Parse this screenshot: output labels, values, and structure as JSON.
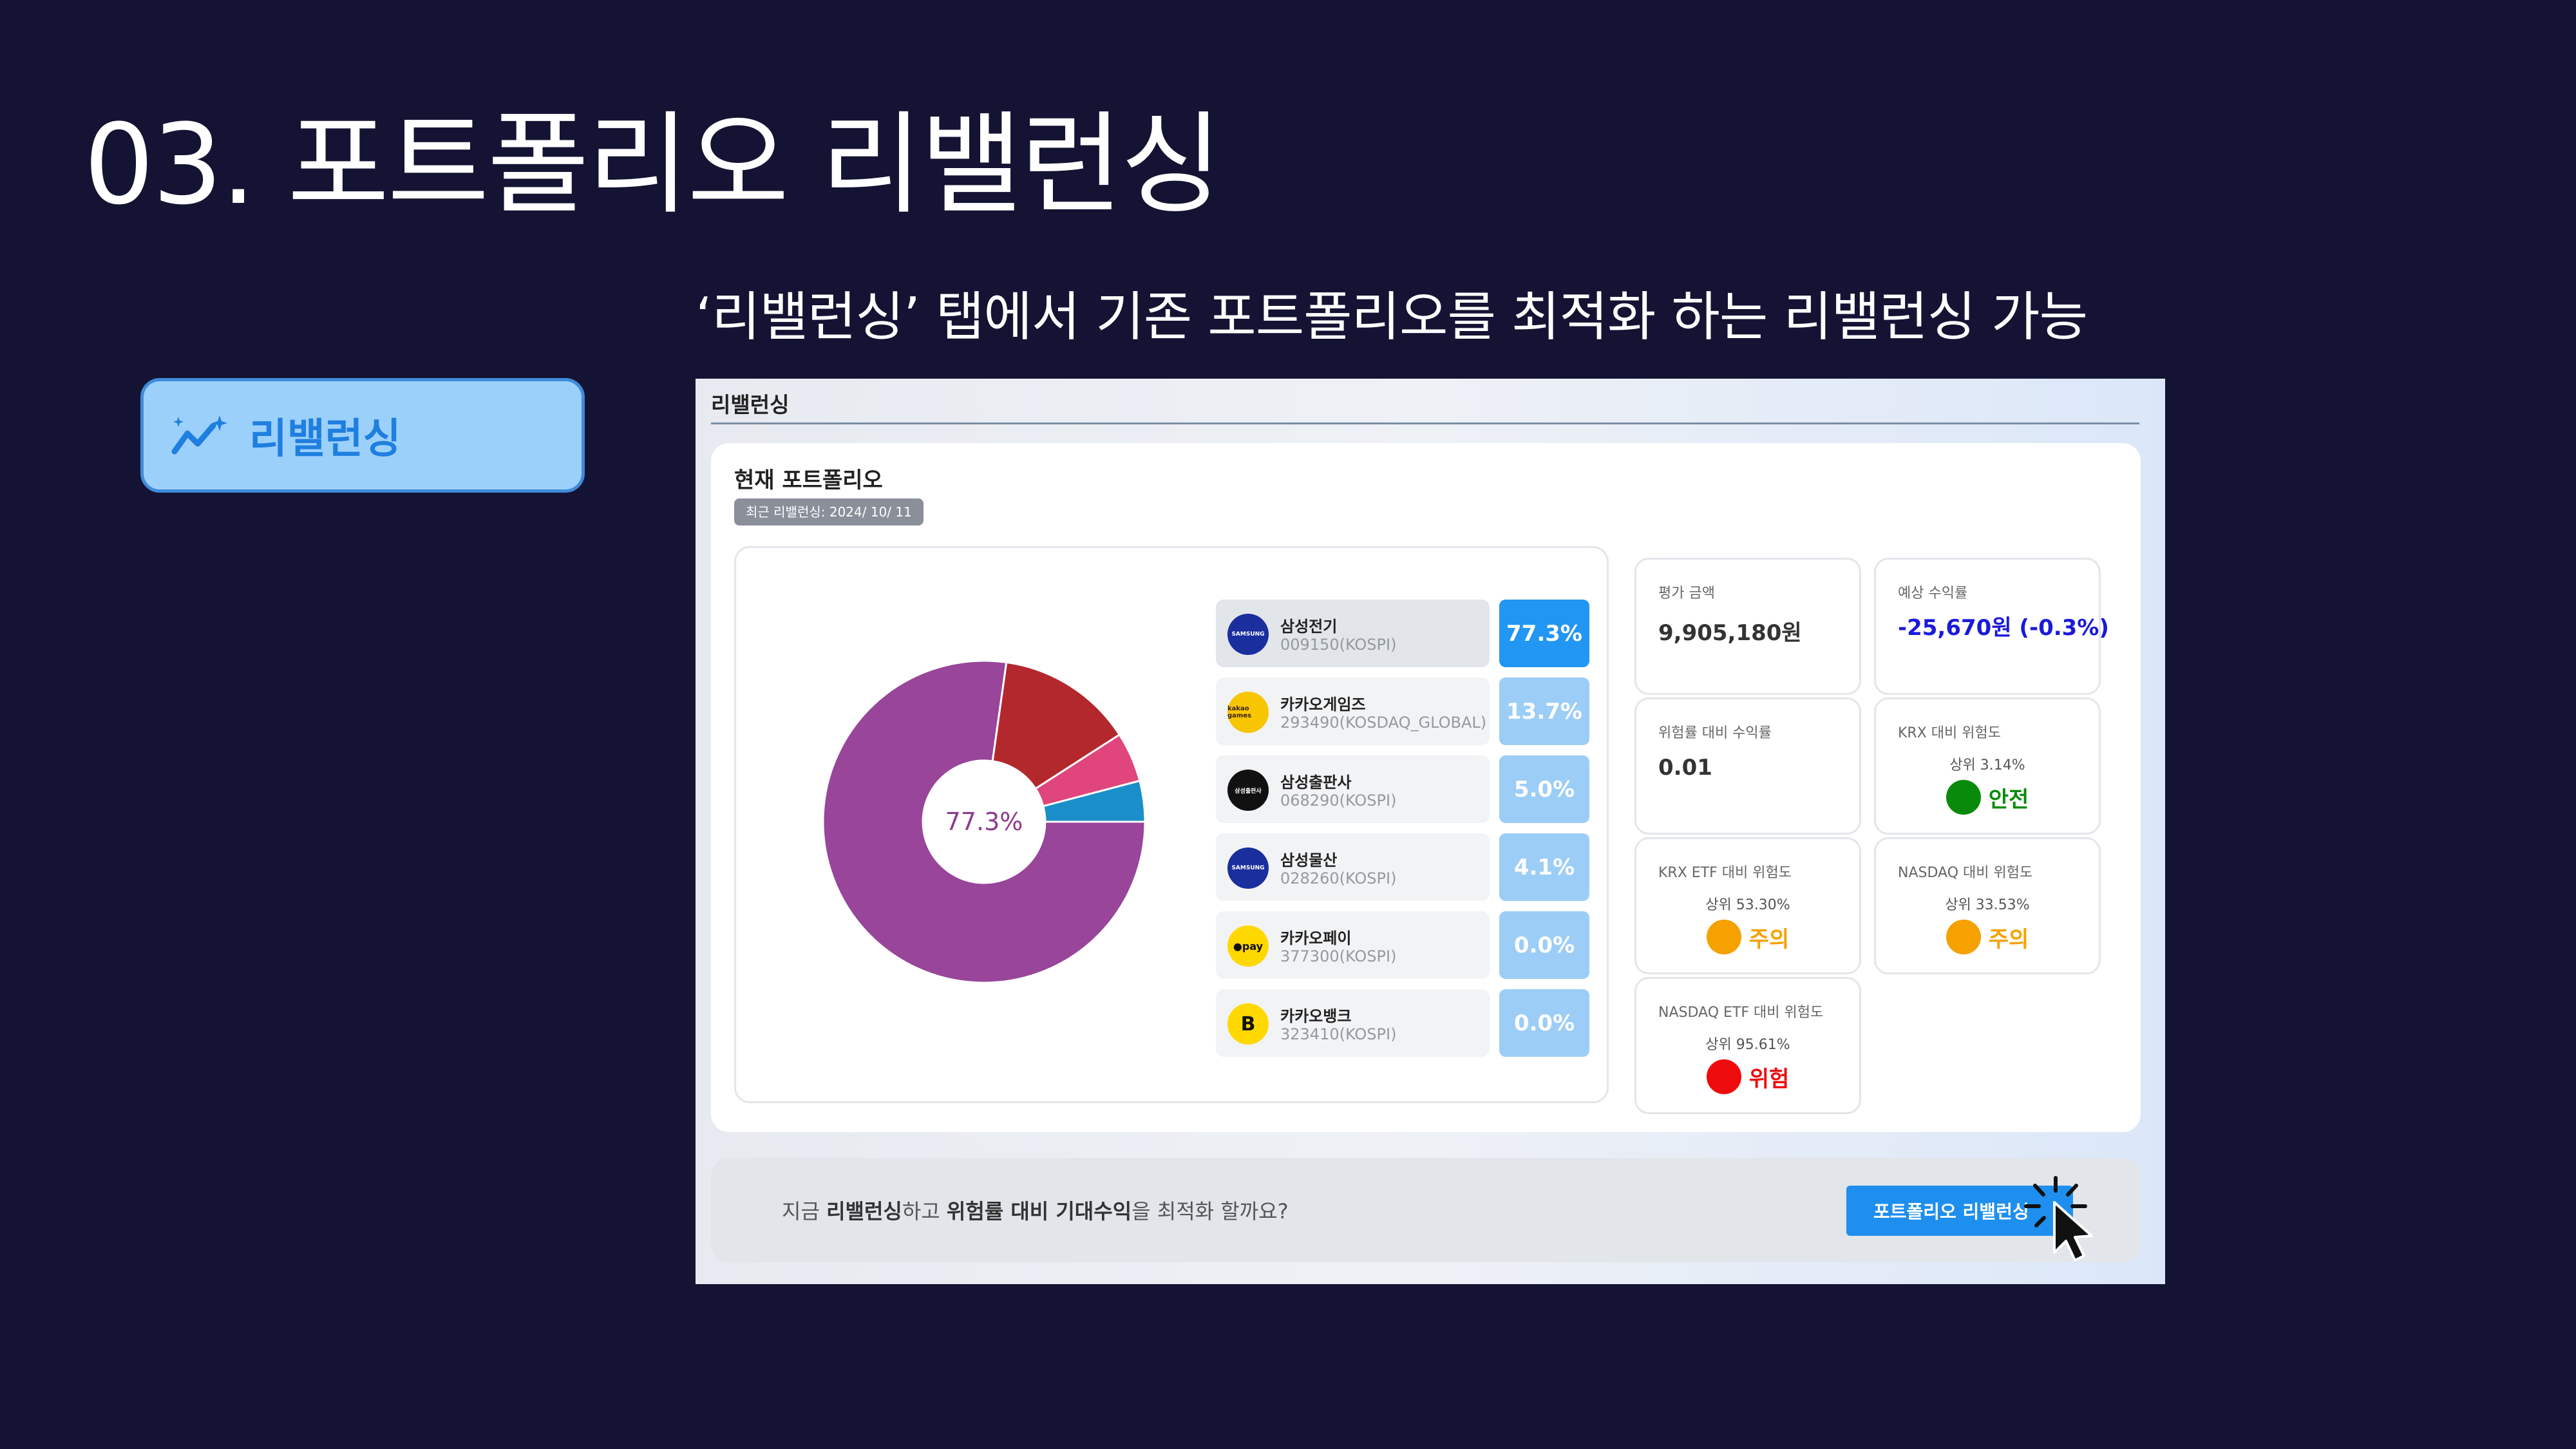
{
  "slide": {
    "title": "03. 포트폴리오 리밸런싱",
    "subtitle": "‘리밸런싱’ 탭에서 기존 포트폴리오를 최적화 하는 리밸런싱 가능"
  },
  "feature_tab": {
    "label": "리밸런싱",
    "icon": "sparkle-trend-icon"
  },
  "panel": {
    "header": "리밸런싱",
    "card_title": "현재 포트폴리오",
    "last_rebalance": "최근 리밸런싱: 2024/ 10/ 11",
    "donut_center_label": "77.3%"
  },
  "chart_data": {
    "type": "pie",
    "donut": true,
    "categories": [
      "삼성전기",
      "카카오게임즈",
      "삼성출판사",
      "삼성물산",
      "카카오페이",
      "카카오뱅크"
    ],
    "values": [
      77.3,
      13.7,
      5.0,
      4.1,
      0.0,
      0.0
    ],
    "colors": [
      "#98459a",
      "#b3282d",
      "#e0457b",
      "#1b8fc9",
      "#f7c600",
      "#f7c600"
    ],
    "center_label": "77.3%"
  },
  "holdings": [
    {
      "name": "삼성전기",
      "code": "009150(KOSPI)",
      "weight": "77.3%",
      "logo": "SAMSUNG",
      "logo_style": "samsung",
      "selected": true
    },
    {
      "name": "카카오게임즈",
      "code": "293490(KOSDAQ_GLOBAL)",
      "weight": "13.7%",
      "logo": "kakao games",
      "logo_style": "kakao",
      "selected": false
    },
    {
      "name": "삼성출판사",
      "code": "068290(KOSPI)",
      "weight": "5.0%",
      "logo": "삼성출판사",
      "logo_style": "black",
      "selected": false
    },
    {
      "name": "삼성물산",
      "code": "028260(KOSPI)",
      "weight": "4.1%",
      "logo": "SAMSUNG",
      "logo_style": "samsung",
      "selected": false
    },
    {
      "name": "카카오페이",
      "code": "377300(KOSPI)",
      "weight": "0.0%",
      "logo": "●pay",
      "logo_style": "pay",
      "selected": false
    },
    {
      "name": "카카오뱅크",
      "code": "323410(KOSPI)",
      "weight": "0.0%",
      "logo": "B",
      "logo_style": "bank",
      "selected": false
    }
  ],
  "metrics": {
    "valuation": {
      "label": "평가 금액",
      "value": "9,905,180원"
    },
    "expected_return": {
      "label": "예상 수익률",
      "value": "-25,670원 (-0.3%)"
    },
    "risk_adjusted_return": {
      "label": "위험률 대비 수익률",
      "value": "0.01"
    },
    "krx_risk": {
      "label": "KRX 대비 위험도",
      "rank": "상위 3.14%",
      "status": "안전"
    },
    "krx_etf_risk": {
      "label": "KRX ETF 대비 위험도",
      "rank": "상위 53.30%",
      "status": "주의"
    },
    "nasdaq_risk": {
      "label": "NASDAQ 대비 위험도",
      "rank": "상위 33.53%",
      "status": "주의"
    },
    "nasdaq_etf_risk": {
      "label": "NASDAQ ETF 대비 위험도",
      "rank": "상위 95.61%",
      "status": "위험"
    }
  },
  "risk_colors": {
    "safe": "#0a8a0a",
    "warn": "#f5a100",
    "danger": "#ef0c0c"
  },
  "bottom": {
    "prefix": "지금 ",
    "bold1": "리밸런싱",
    "mid": "하고 ",
    "bold2": "위험률 대비 기대수익",
    "suffix": "을 최적화 할까요?",
    "button_label": "포트폴리오 리밸런싱"
  }
}
